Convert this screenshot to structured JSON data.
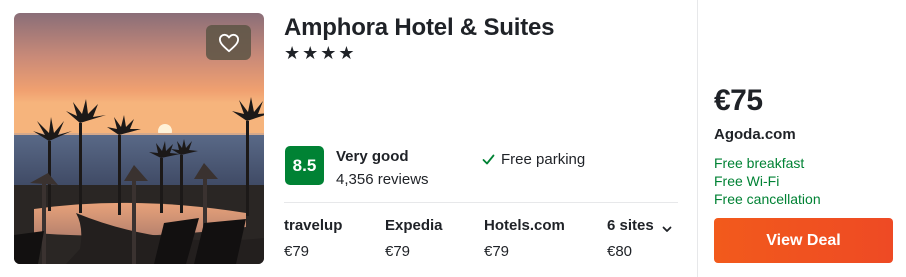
{
  "hotel": {
    "name": "Amphora Hotel & Suites",
    "stars": "★★★★",
    "rating_score": "8.5",
    "rating_label": "Very good",
    "reviews": "4,356 reviews",
    "amenity": "Free parking"
  },
  "sites": [
    {
      "name": "travelup",
      "price": "€79"
    },
    {
      "name": "Expedia",
      "price": "€79"
    },
    {
      "name": "Hotels.com",
      "price": "€79"
    },
    {
      "name": "6 sites",
      "price": "€80"
    }
  ],
  "deal": {
    "price": "€75",
    "provider": "Agoda.com",
    "perks": [
      "Free breakfast",
      "Free Wi-Fi",
      "Free cancellation"
    ],
    "button_label": "View Deal"
  },
  "icons": {
    "favorite": "heart-icon",
    "amenity": "check-icon",
    "more_sites": "chevron-down-icon"
  },
  "colors": {
    "rating_badge": "#008234",
    "perk_text": "#008234",
    "deal_button": "#f0501e"
  }
}
